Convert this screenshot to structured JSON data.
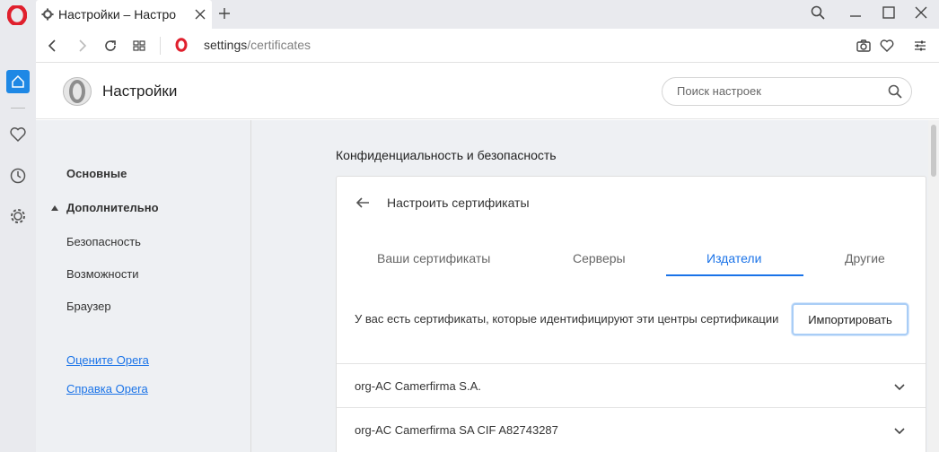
{
  "browser": {
    "tab_title": "Настройки – Настро",
    "url_host": "settings",
    "url_path": "/certificates"
  },
  "settings": {
    "title": "Настройки",
    "search_placeholder": "Поиск настроек"
  },
  "nav": {
    "basic": "Основные",
    "advanced": "Дополнительно",
    "items": [
      "Безопасность",
      "Возможности",
      "Браузер"
    ],
    "links": [
      "Оцените Opera",
      "Справка Opera"
    ]
  },
  "main": {
    "section_title": "Конфиденциальность и безопасность",
    "card_title": "Настроить сертификаты",
    "tabs": [
      "Ваши сертификаты",
      "Серверы",
      "Издатели",
      "Другие"
    ],
    "active_tab": "Издатели",
    "description": "У вас есть сертификаты, которые идентифицируют эти центры сертификации",
    "import_button": "Импортировать",
    "certificates": [
      "org-AC Camerfirma S.A.",
      "org-AC Camerfirma SA CIF A82743287"
    ]
  },
  "colors": {
    "accent": "#1a73e8",
    "opera_red": "#e0202d",
    "sidebar_active": "#1e88e5"
  },
  "icons": [
    "opera-logo-icon",
    "settings-gear-icon",
    "close-icon",
    "plus-icon",
    "search-icon",
    "minimize-icon",
    "maximize-icon",
    "back-icon",
    "forward-icon",
    "reload-icon",
    "tabs-grid-icon",
    "camera-icon",
    "heart-icon",
    "easy-setup-icon",
    "home-icon",
    "history-clock-icon",
    "gear-icon",
    "arrow-left-icon",
    "chevron-down-icon"
  ]
}
